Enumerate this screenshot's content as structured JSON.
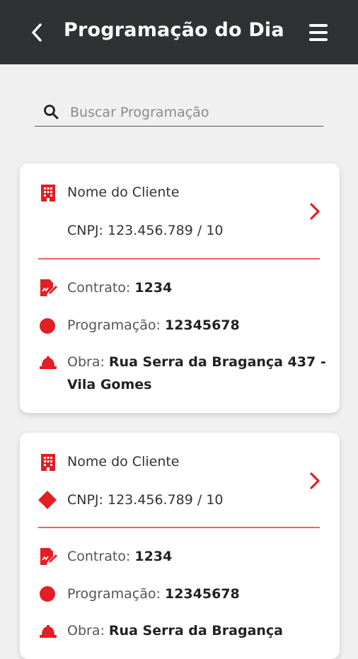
{
  "header": {
    "title": "Programação do Dia",
    "back_icon": "chevron-left-icon",
    "menu_icon": "hamburger-menu-icon",
    "background": "#2f3233"
  },
  "search": {
    "placeholder": "Buscar Programação",
    "value": ""
  },
  "accent_color": "#e31e24",
  "cards": [
    {
      "client_name": "Nome do Cliente",
      "cnpj": "CNPJ: 123.456.789 / 10",
      "contract_label": "Contrato:",
      "contract_value": "1234",
      "program_label": "Programação:",
      "program_value": "12345678",
      "work_label": "Obra:",
      "work_value": "Rua Serra da Bragança 437 - Vila Gomes"
    },
    {
      "client_name": "Nome do Cliente",
      "cnpj": "CNPJ: 123.456.789 / 10",
      "contract_label": "Contrato:",
      "contract_value": "1234",
      "program_label": "Programação:",
      "program_value": "12345678",
      "work_label": "Obra:",
      "work_value": "Rua Serra da Bragança"
    }
  ]
}
